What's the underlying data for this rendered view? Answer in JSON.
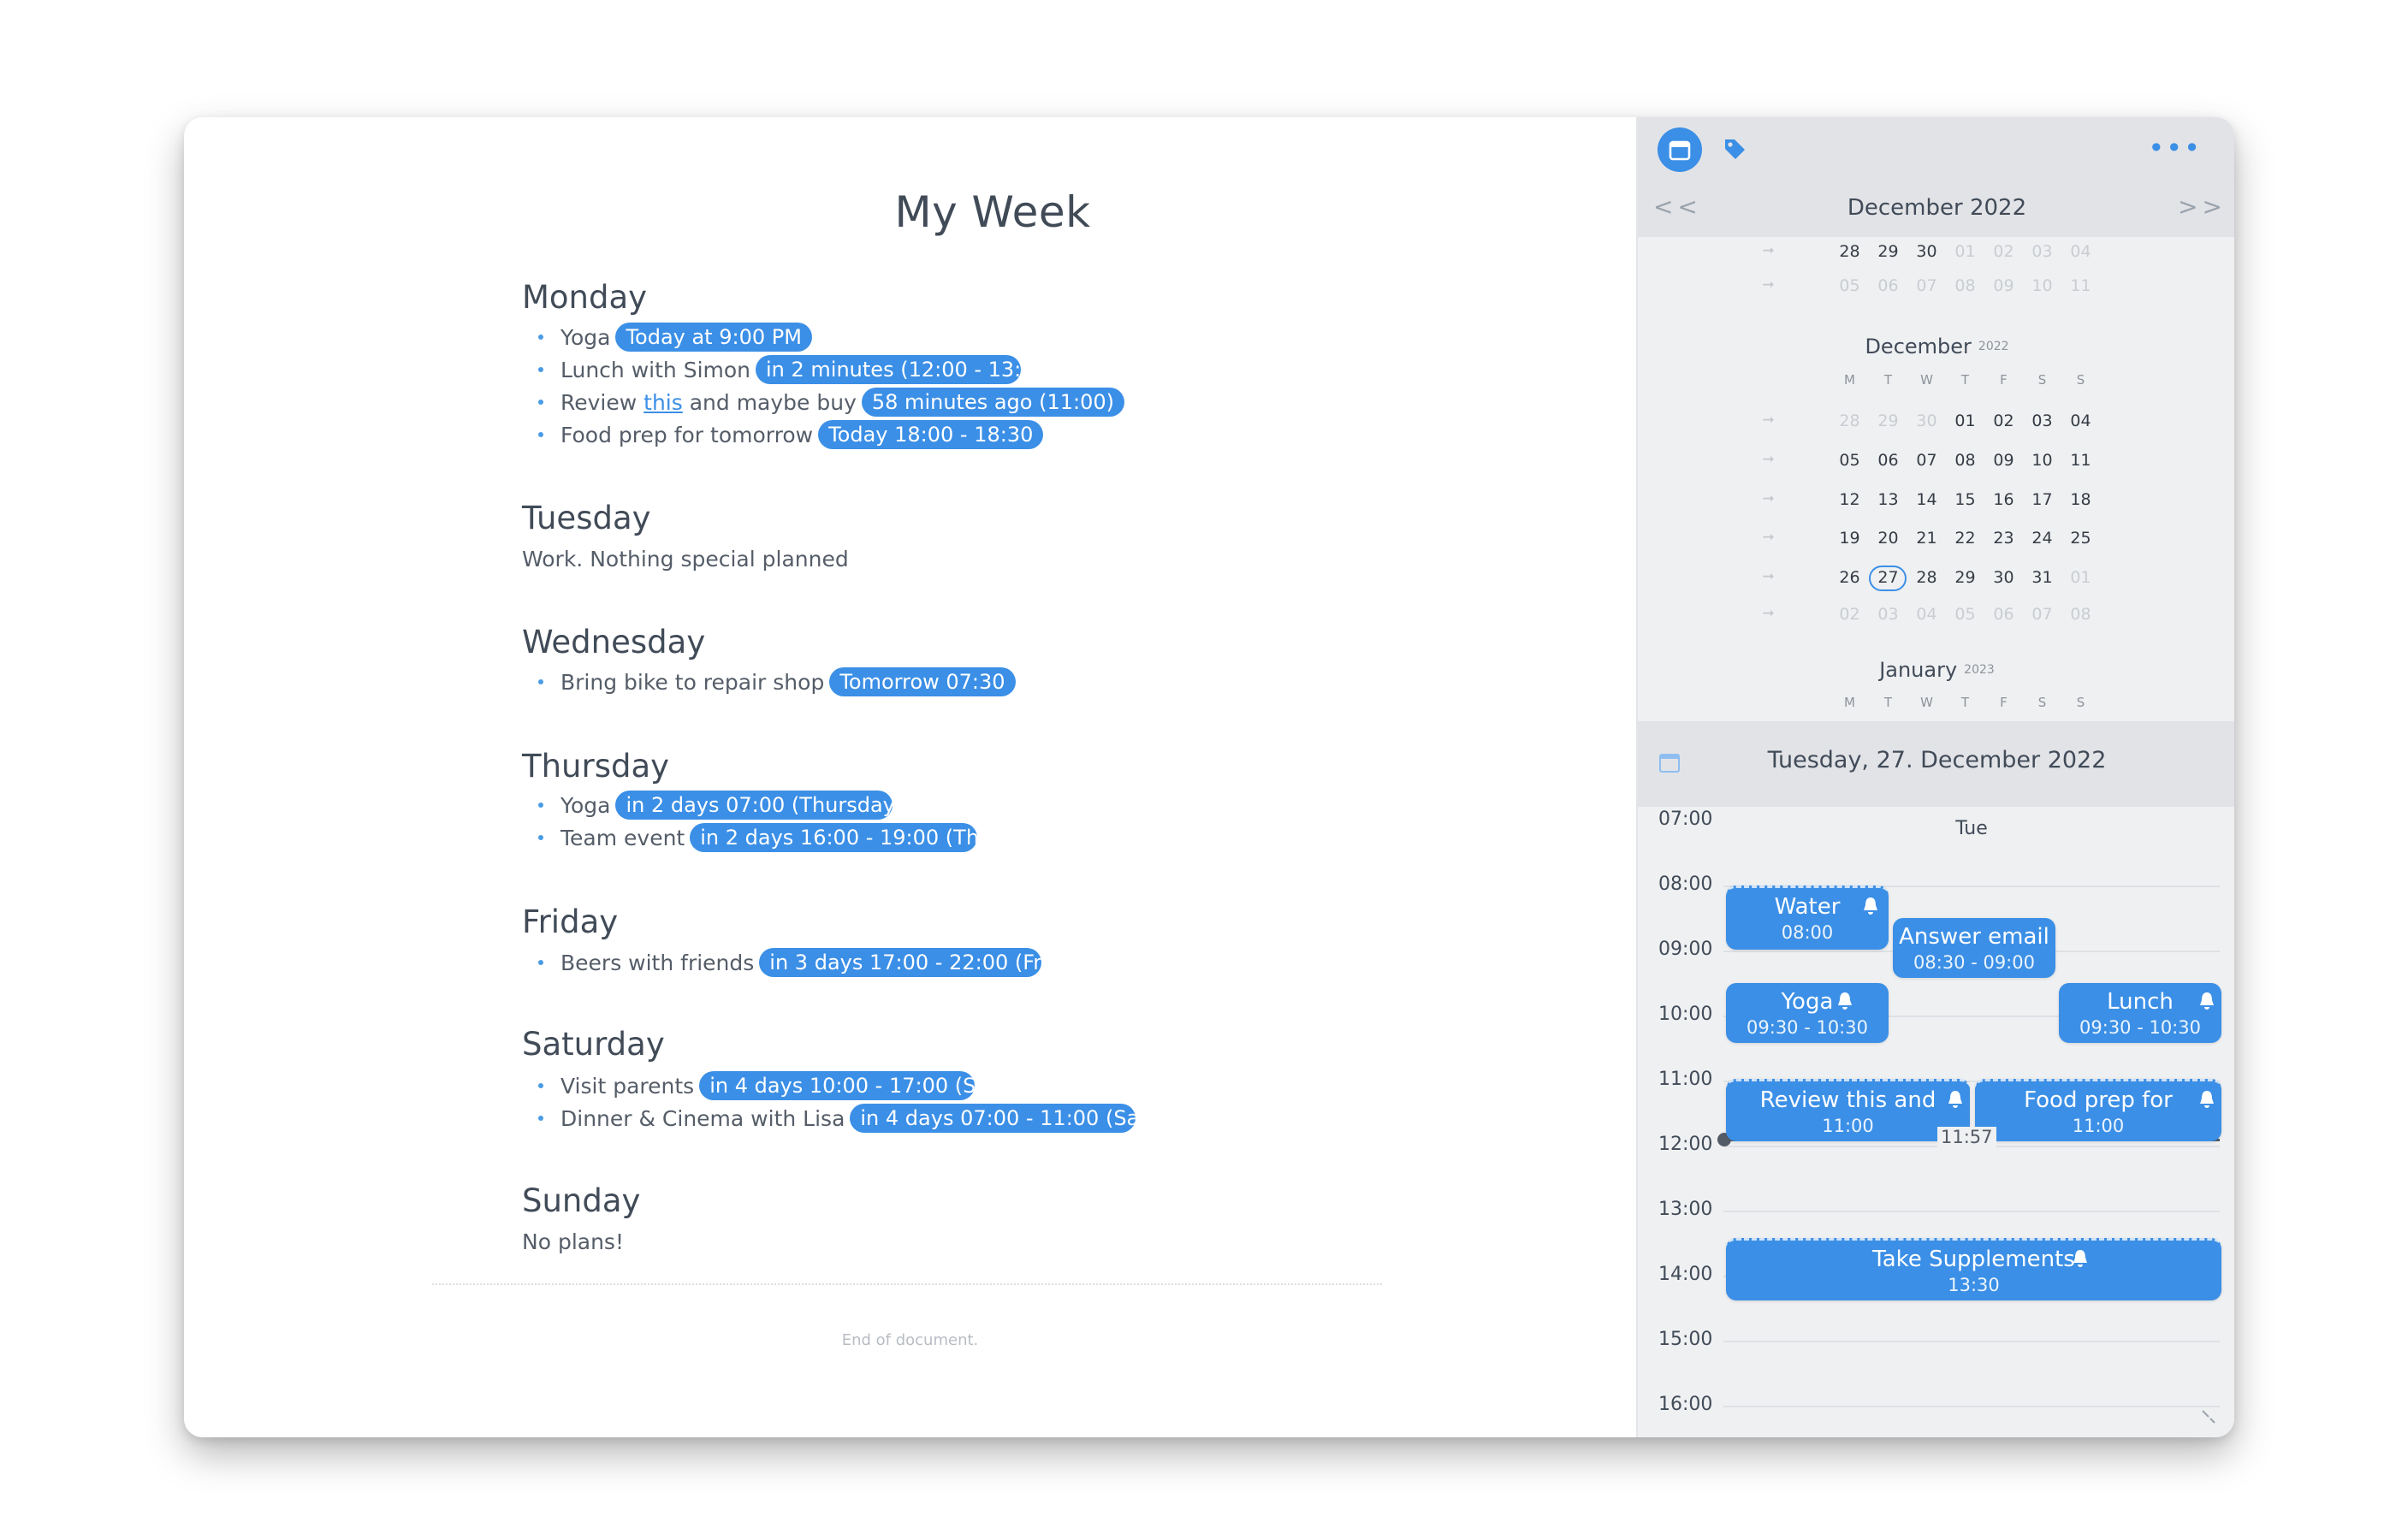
{
  "doc": {
    "title": "My Week",
    "days": [
      {
        "name": "Monday",
        "items": [
          {
            "text": "Yoga",
            "pill": "Today at 9:00 PM"
          },
          {
            "text": "Lunch with Simon",
            "pill": "in 2 minutes (12:00 - 13:30"
          },
          {
            "text_before": "Review ",
            "link": "this",
            "text_after": " and maybe buy",
            "pill": "58 minutes ago (11:00)"
          },
          {
            "text": "Food prep for tomorrow",
            "pill": "Today 18:00 - 18:30"
          }
        ]
      },
      {
        "name": "Tuesday",
        "note": "Work. Nothing special planned"
      },
      {
        "name": "Wednesday",
        "items": [
          {
            "text": "Bring bike to repair shop",
            "pill": "Tomorrow 07:30"
          }
        ]
      },
      {
        "name": "Thursday",
        "items": [
          {
            "text": "Yoga",
            "pill": "in 2 days 07:00 (Thursday,"
          },
          {
            "text": "Team event",
            "pill": "in 2 days 16:00 - 19:00 (Th"
          }
        ]
      },
      {
        "name": "Friday",
        "items": [
          {
            "text": "Beers with friends",
            "pill": "in 3 days 17:00 - 22:00 (Fri"
          }
        ]
      },
      {
        "name": "Saturday",
        "items": [
          {
            "text": "Visit parents",
            "pill": "in 4 days 10:00 - 17:00 (Sat"
          },
          {
            "text": "Dinner & Cinema with Lisa",
            "pill": "in 4 days 07:00 - 11:00 (Sat"
          }
        ]
      },
      {
        "name": "Sunday",
        "note": "No plans!"
      }
    ],
    "end_text": "End of document."
  },
  "side": {
    "calendar_icon": "calendar-icon",
    "tag_icon": "tag-icon",
    "more_icon": "more-icon",
    "more_label": "•••",
    "prev": "< <",
    "next": "> >",
    "month_title": "December 2022",
    "nov_tail_rows": [
      [
        "28",
        "29",
        "30",
        "01",
        "02",
        "03",
        "04"
      ],
      [
        "05",
        "06",
        "07",
        "08",
        "09",
        "10",
        "11"
      ]
    ],
    "december": {
      "label": "December",
      "year": "2022",
      "weekday_headers": [
        "M",
        "T",
        "W",
        "T",
        "F",
        "S",
        "S"
      ],
      "rows": [
        [
          "28",
          "29",
          "30",
          "01",
          "02",
          "03",
          "04"
        ],
        [
          "05",
          "06",
          "07",
          "08",
          "09",
          "10",
          "11"
        ],
        [
          "12",
          "13",
          "14",
          "15",
          "16",
          "17",
          "18"
        ],
        [
          "19",
          "20",
          "21",
          "22",
          "23",
          "24",
          "25"
        ],
        [
          "26",
          "27",
          "28",
          "29",
          "30",
          "31",
          "01"
        ],
        [
          "02",
          "03",
          "04",
          "05",
          "06",
          "07",
          "08"
        ]
      ],
      "today": "27"
    },
    "january": {
      "label": "January",
      "year": "2023",
      "weekday_headers": [
        "M",
        "T",
        "W",
        "T",
        "F",
        "S",
        "S"
      ]
    },
    "week_arrow": "➞",
    "day_title": "Tuesday, 27. December 2022",
    "day_col": "Tue",
    "hours": [
      "07:00",
      "08:00",
      "09:00",
      "10:00",
      "11:00",
      "12:00",
      "13:00",
      "14:00",
      "15:00",
      "16:00"
    ],
    "now": "11:57",
    "events": [
      {
        "title": "Water",
        "time": "08:00"
      },
      {
        "title": "Answer email",
        "time": "08:30 - 09:00"
      },
      {
        "title": "Yoga",
        "time": "09:30 - 10:30"
      },
      {
        "title": "Lunch",
        "time": "09:30 - 10:30"
      },
      {
        "title": "Review this and",
        "time": "11:00"
      },
      {
        "title": "Food prep for",
        "time": "11:00"
      },
      {
        "title": "Take Supplements",
        "time": "13:30"
      }
    ],
    "colors": {
      "accent": "#3b8fe6",
      "panel": "#eff0f2",
      "header": "#e2e3e7"
    }
  }
}
